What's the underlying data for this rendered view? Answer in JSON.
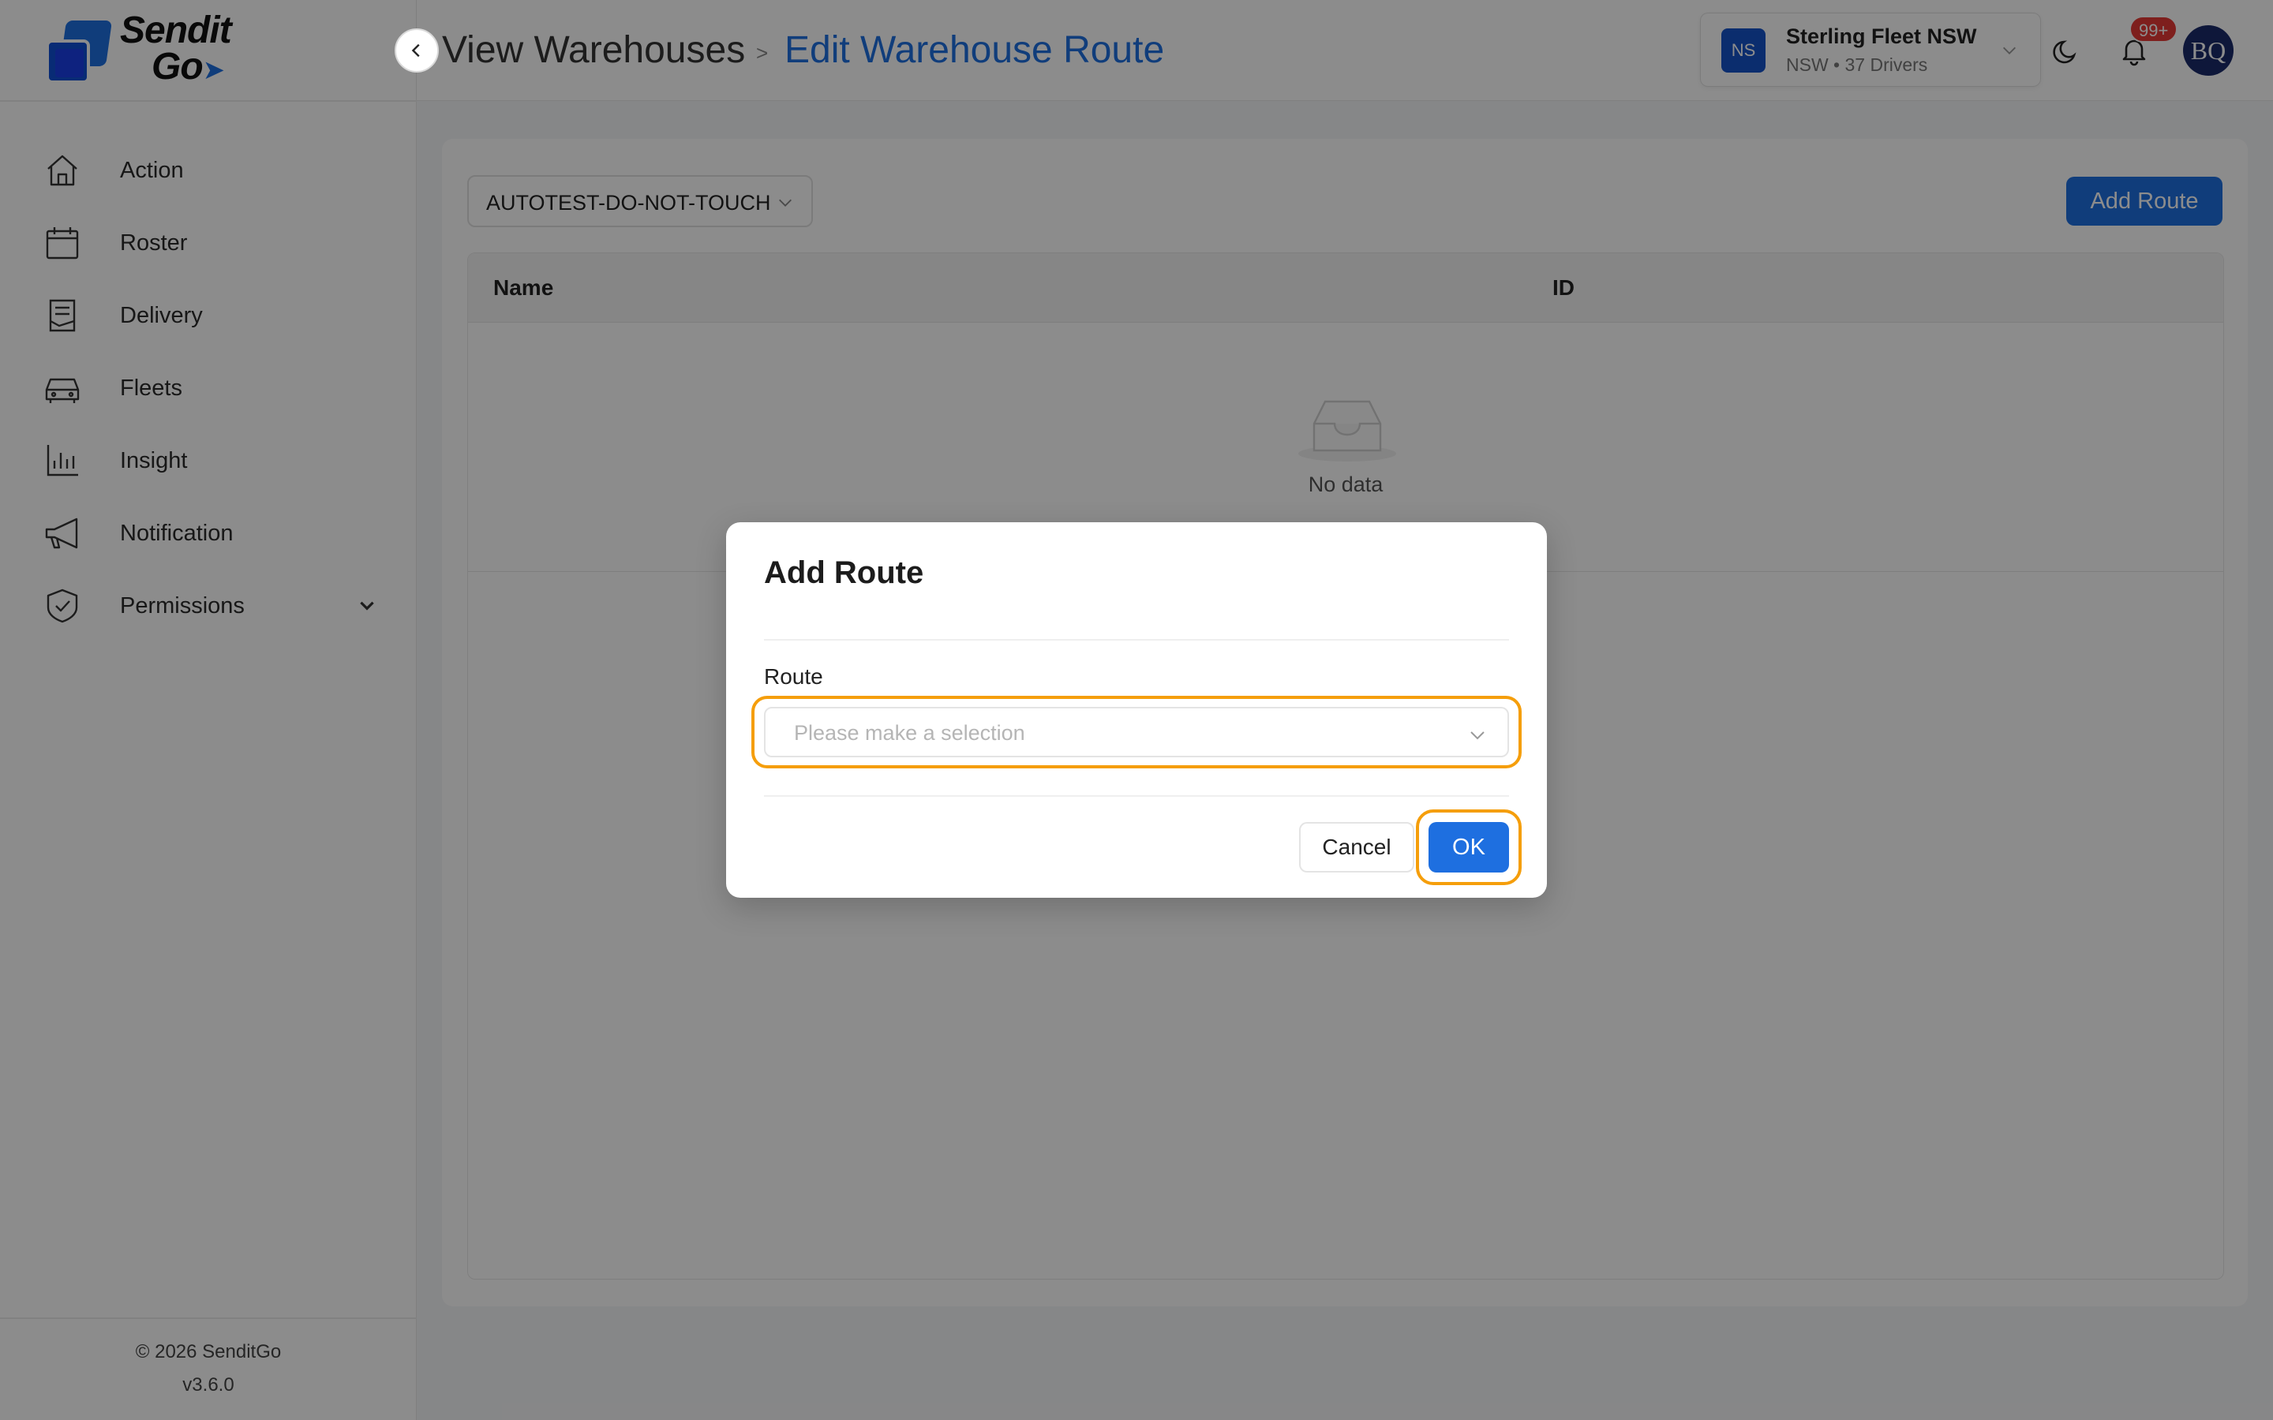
{
  "app": {
    "logo_line1": "Sendit",
    "logo_line2": "Go",
    "copyright": "© 2026 SenditGo",
    "version": "v3.6.0"
  },
  "sidebar": {
    "items": [
      {
        "label": "Action",
        "icon": "home-icon"
      },
      {
        "label": "Roster",
        "icon": "calendar-icon"
      },
      {
        "label": "Delivery",
        "icon": "clipboard-icon"
      },
      {
        "label": "Fleets",
        "icon": "car-icon"
      },
      {
        "label": "Insight",
        "icon": "bar-chart-icon"
      },
      {
        "label": "Notification",
        "icon": "megaphone-icon"
      },
      {
        "label": "Permissions",
        "icon": "shield-check-icon"
      }
    ]
  },
  "header": {
    "breadcrumb_parent": "View Warehouses",
    "breadcrumb_separator": ">",
    "breadcrumb_current": "Edit Warehouse Route",
    "fleet": {
      "badge": "NS",
      "name": "Sterling Fleet NSW",
      "subtitle": "NSW • 37 Drivers"
    },
    "notification_count": "99+",
    "avatar_initials": "BQ"
  },
  "main": {
    "warehouse_selected": "AUTOTEST-DO-NOT-TOUCH",
    "add_route_label": "Add Route",
    "table": {
      "columns": [
        "Name",
        "ID"
      ],
      "empty_text": "No data"
    }
  },
  "modal": {
    "title": "Add Route",
    "route_label": "Route",
    "route_placeholder": "Please make a selection",
    "cancel_label": "Cancel",
    "ok_label": "OK"
  },
  "colors": {
    "accent": "#1e6fe0",
    "highlight": "#f59e0b",
    "badge": "#e53935"
  }
}
